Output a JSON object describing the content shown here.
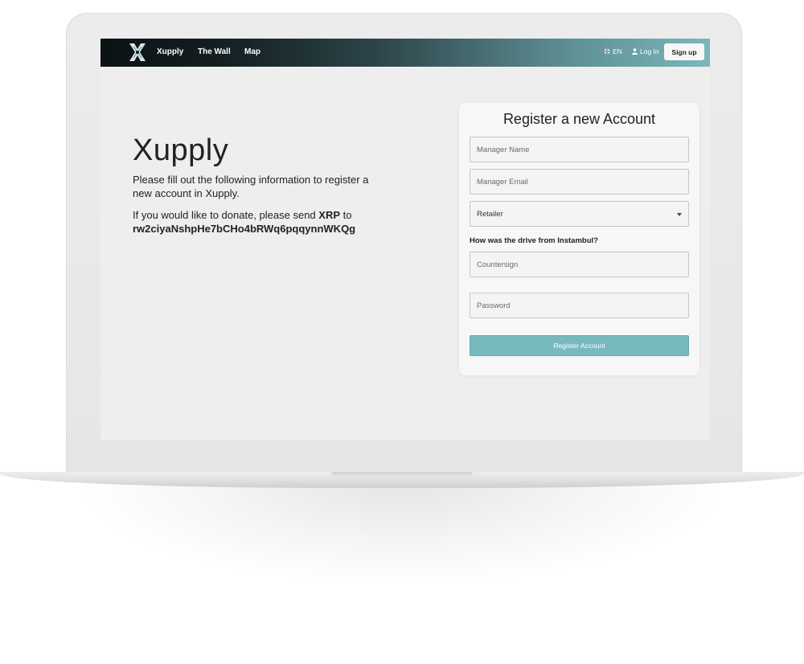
{
  "navbar": {
    "brand": "Xupply",
    "links": [
      "The Wall",
      "Map"
    ],
    "language": "EN",
    "login_label": "Log In",
    "signup_label": "Sign up"
  },
  "hero": {
    "title": "Xupply",
    "description": "Please fill out the following information to register a new account in Xupply.",
    "donate_prefix": "If you would like to donate, please send",
    "donate_currency": "XRP",
    "donate_to": "to",
    "donate_address": "rw2ciyaNshpHe7bCHo4bRWq6pqqynnWKQg"
  },
  "register_form": {
    "title": "Register a new Account",
    "manager_name_placeholder": "Manager Name",
    "manager_email_placeholder": "Manager Email",
    "role_selected": "Retailer",
    "question": "How was the drive from Instambul?",
    "countersign_placeholder": "Countersign",
    "password_placeholder": "Password",
    "submit_label": "Register Account"
  },
  "colors": {
    "accent": "#78b9be",
    "navbar_dark": "#0b1214",
    "navbar_light": "#7bb8bc"
  },
  "icons": {
    "logo": "xupply-x-logo",
    "language": "globe-icon",
    "login": "user-icon",
    "select": "caret-down-icon"
  }
}
